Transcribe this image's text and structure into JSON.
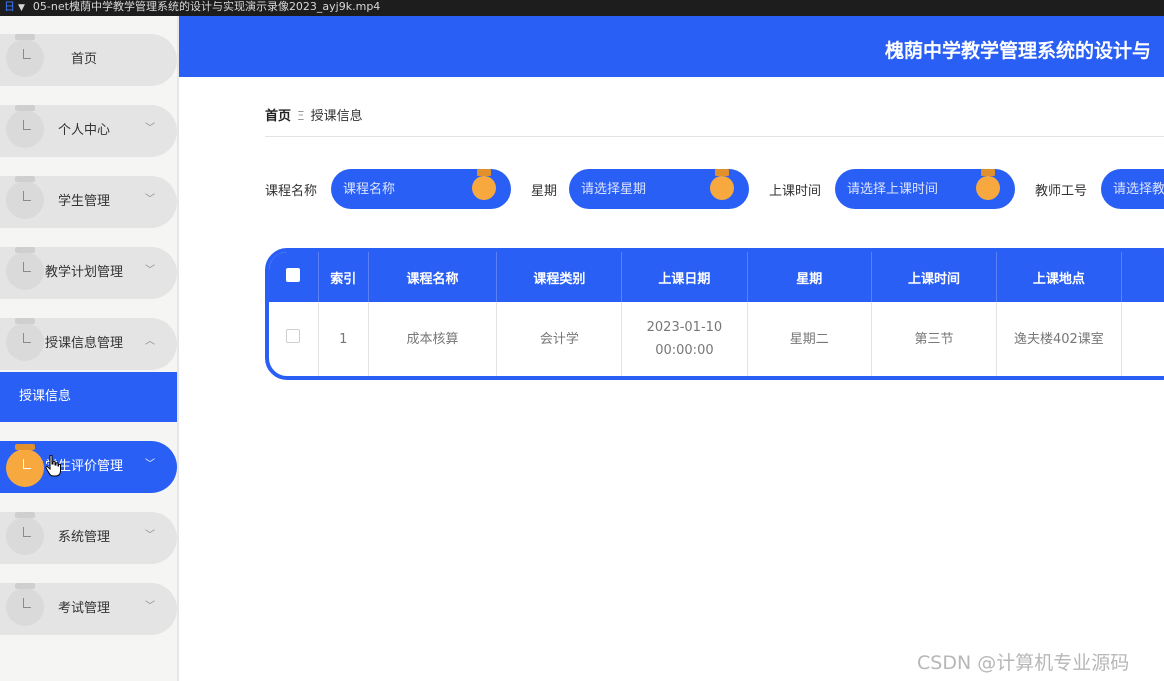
{
  "window": {
    "title": "05-net槐荫中学教学管理系统的设计与实现演示录像2023_ayj9k.mp4"
  },
  "header": {
    "title": "槐荫中学教学管理系统的设计与"
  },
  "sidebar": {
    "items": [
      {
        "label": "首页",
        "has_chevron": false
      },
      {
        "label": "个人中心",
        "has_chevron": true
      },
      {
        "label": "学生管理",
        "has_chevron": true
      },
      {
        "label": "教学计划管理",
        "has_chevron": true
      },
      {
        "label": "授课信息管理",
        "has_chevron": true,
        "expanded": true
      },
      {
        "label": "学生评价管理",
        "has_chevron": true,
        "hovered": true
      },
      {
        "label": "系统管理",
        "has_chevron": true
      },
      {
        "label": "考试管理",
        "has_chevron": true
      }
    ],
    "sub_item": {
      "label": "授课信息"
    }
  },
  "breadcrumb": {
    "home": "首页",
    "separator": "Ξ",
    "current": "授课信息"
  },
  "search": {
    "course_name": {
      "label": "课程名称",
      "placeholder": "课程名称"
    },
    "weekday": {
      "label": "星期",
      "placeholder": "请选择星期"
    },
    "class_time": {
      "label": "上课时间",
      "placeholder": "请选择上课时间"
    },
    "teacher_id": {
      "label": "教师工号",
      "placeholder": "请选择教"
    }
  },
  "table": {
    "headers": [
      "索引",
      "课程名称",
      "课程类别",
      "上课日期",
      "星期",
      "上课时间",
      "上课地点"
    ],
    "rows": [
      [
        "1",
        "成本核算",
        "会计学",
        "2023-01-10 00:00:00",
        "星期二",
        "第三节",
        "逸夫楼402课室"
      ]
    ]
  },
  "watermark": "CSDN @计算机专业源码",
  "colors": {
    "primary": "#2a5ff5",
    "accent": "#f7a940",
    "sidebar_bg": "#f5f5f3"
  }
}
